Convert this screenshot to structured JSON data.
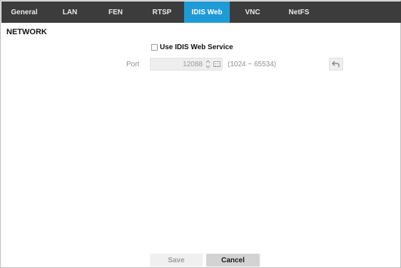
{
  "tabs": [
    {
      "label": "General",
      "active": false
    },
    {
      "label": "LAN",
      "active": false
    },
    {
      "label": "FEN",
      "active": false
    },
    {
      "label": "RTSP",
      "active": false
    },
    {
      "label": "IDIS Web",
      "active": true
    },
    {
      "label": "VNC",
      "active": false
    },
    {
      "label": "NetFS",
      "active": false
    }
  ],
  "section": {
    "title": "NETWORK"
  },
  "web_service": {
    "label": "Use IDIS Web Service",
    "checked": false
  },
  "port": {
    "label": "Port",
    "value": "12088",
    "range": "(1024 ~ 65534)",
    "spin_icon": "spin-arrows-icon",
    "keyboard_icon": "keyboard-icon",
    "undo_icon": "undo-arrow-icon"
  },
  "footer": {
    "save_label": "Save",
    "cancel_label": "Cancel"
  },
  "colors": {
    "tabbar_bg": "#3c3c3c",
    "tab_active_bg": "#1e9bd7",
    "disabled_text": "#9a9a9a"
  }
}
